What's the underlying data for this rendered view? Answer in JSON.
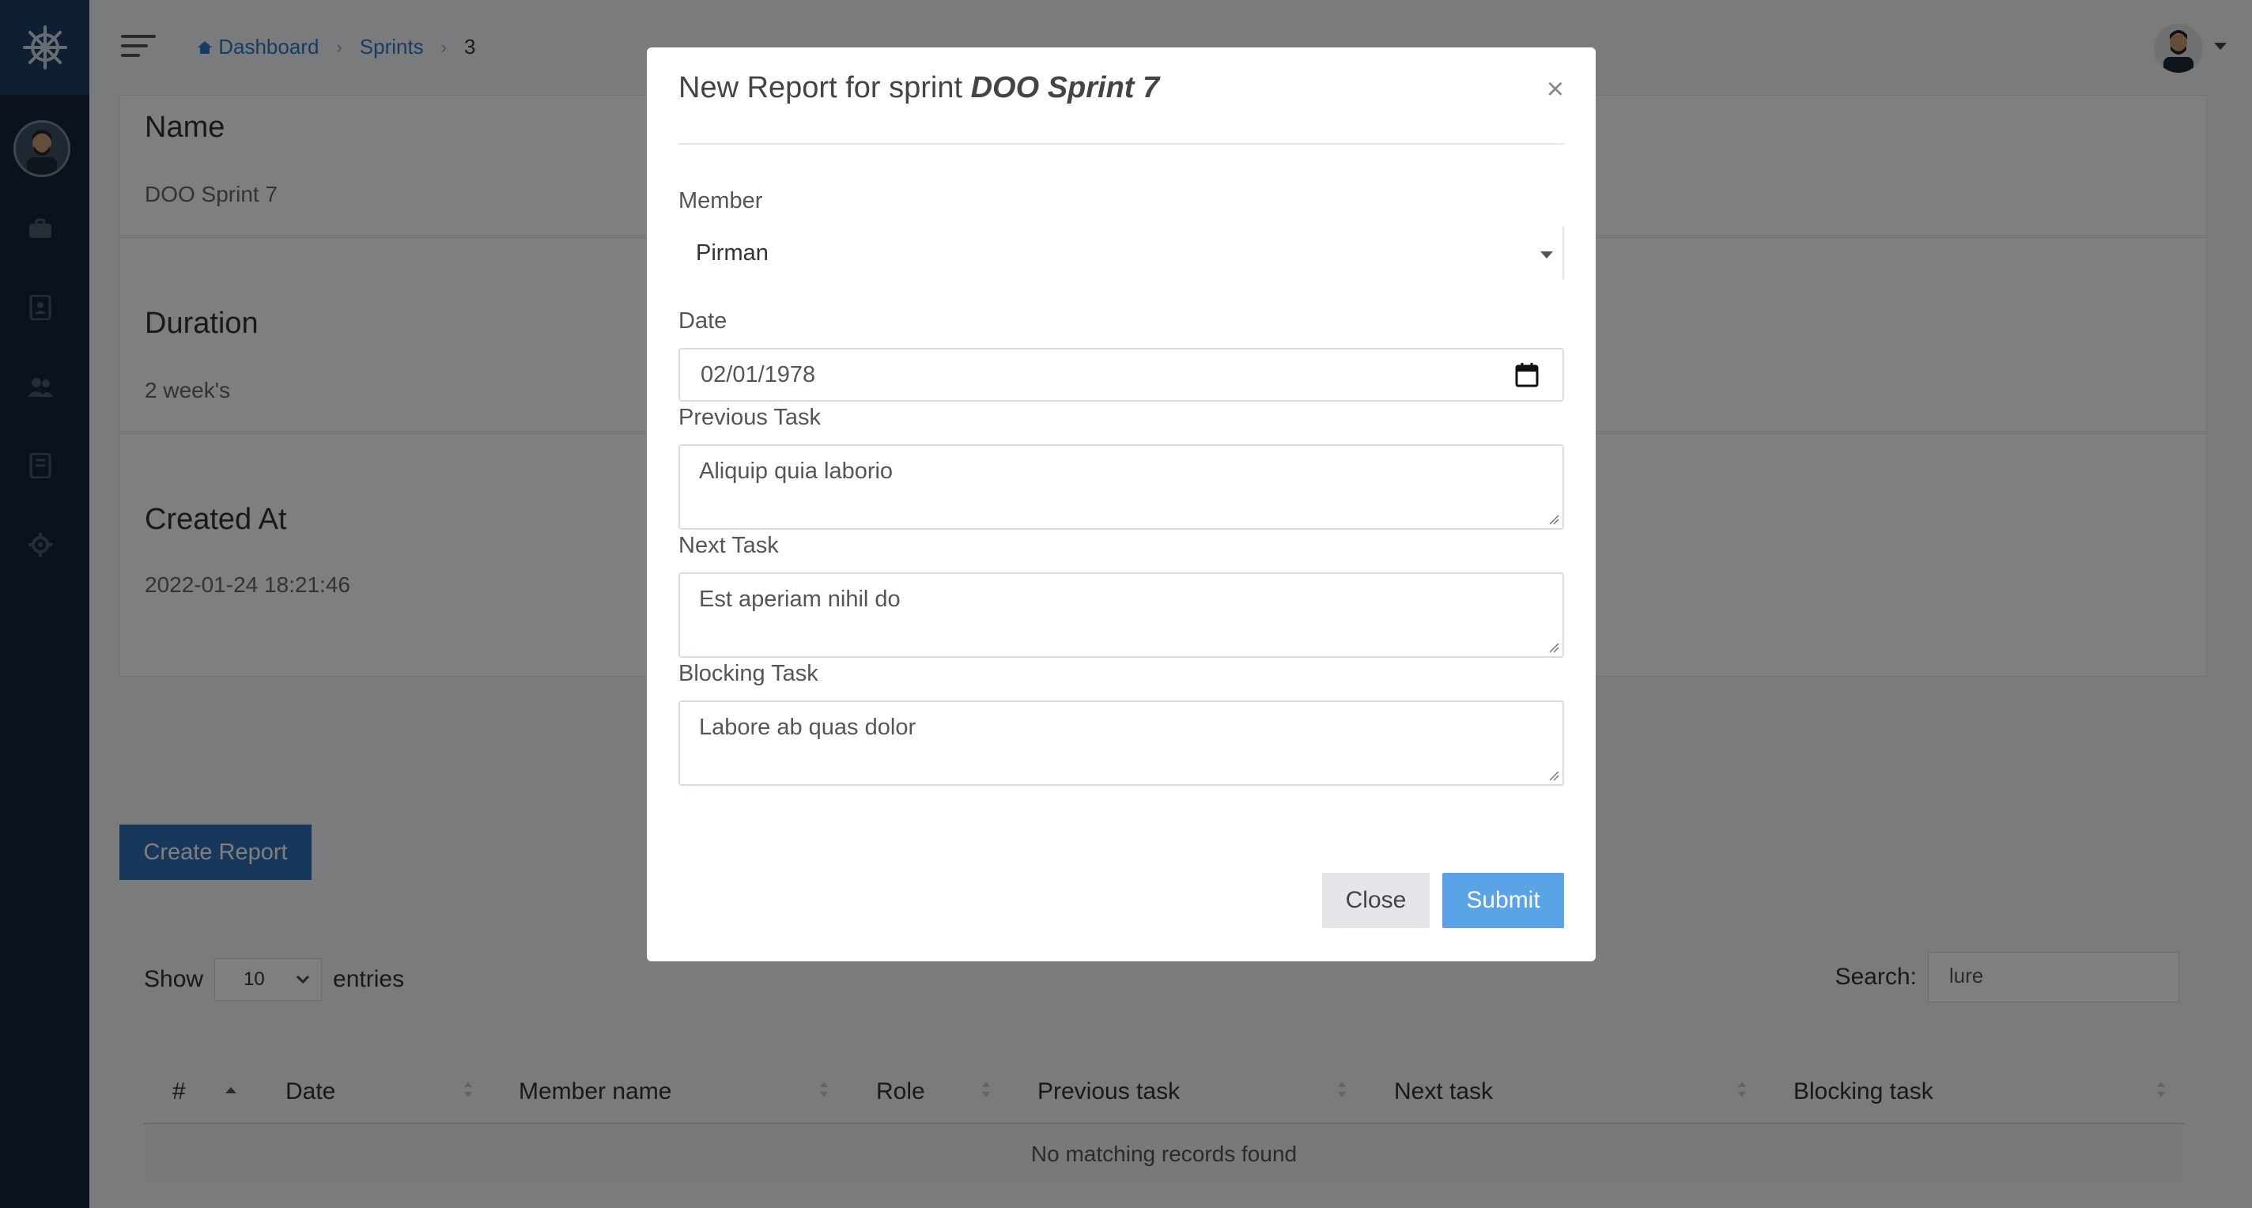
{
  "breadcrumb": {
    "dashboard": "Dashboard",
    "sprints": "Sprints",
    "current": "3"
  },
  "details": {
    "name_label": "Name",
    "name_value": "DOO Sprint 7",
    "duration_label": "Duration",
    "duration_value": "2 week's",
    "created_label": "Created At",
    "created_value": "2022-01-24 18:21:46"
  },
  "actions": {
    "create_report": "Create Report"
  },
  "datatable": {
    "show_label": "Show",
    "entries_value": "10",
    "entries_label": "entries",
    "search_label": "Search:",
    "search_value": "lure",
    "columns": [
      "#",
      "Date",
      "Member name",
      "Role",
      "Previous task",
      "Next task",
      "Blocking task"
    ],
    "empty_message": "No matching records found"
  },
  "modal": {
    "title_prefix": "New Report for sprint",
    "title_sprint": "DOO Sprint 7",
    "close_symbol": "×",
    "member_label": "Member",
    "member_value": "Pirman",
    "date_label": "Date",
    "date_value": "02/01/1978",
    "previous_label": "Previous Task",
    "previous_value": "Aliquip quia laborio",
    "next_label": "Next Task",
    "next_value": "Est aperiam nihil do",
    "blocking_label": "Blocking Task",
    "blocking_value": "Labore ab quas dolor",
    "close_button": "Close",
    "submit_button": "Submit"
  },
  "colors": {
    "sidebar": "#13253a",
    "primary": "#2f6eb6",
    "submit": "#5aa3e6",
    "overlay": "rgba(0,0,0,0.5)"
  },
  "icons": [
    "helm-icon",
    "briefcase-icon",
    "contacts-icon",
    "users-icon",
    "book-icon",
    "gear-icon",
    "home-icon",
    "calendar-icon",
    "menu-icon"
  ]
}
